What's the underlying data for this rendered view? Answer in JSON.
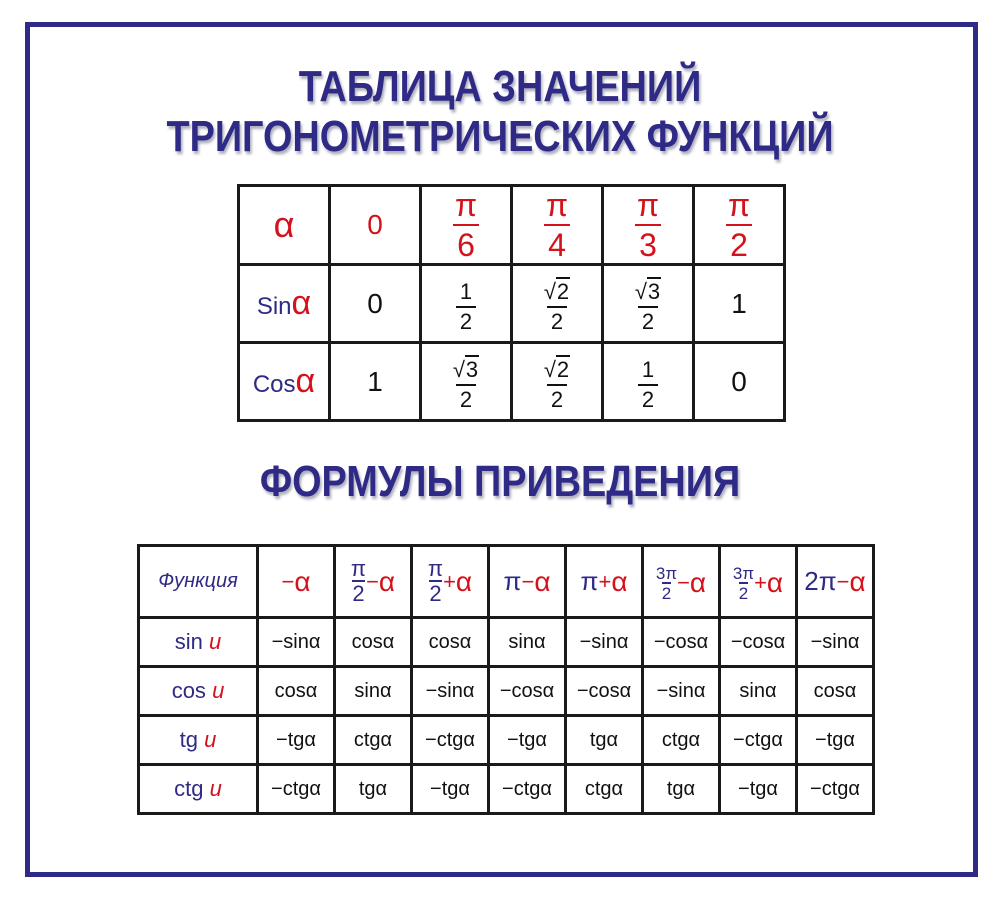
{
  "titles": {
    "main_line1": "ТАБЛИЦА ЗНАЧЕНИЙ",
    "main_line2": "ТРИГОНОМЕТРИЧЕСКИХ ФУНКЦИЙ",
    "section2": "ФОРМУЛЫ ПРИВЕДЕНИЯ"
  },
  "colors": {
    "title": "#2e2a85",
    "accent_red": "#d4121c",
    "grid": "#1a1a1a",
    "frame": "#2e2a85"
  },
  "values_table": {
    "corner": "α",
    "angles": [
      {
        "num": "0",
        "den": ""
      },
      {
        "num": "π",
        "den": "6"
      },
      {
        "num": "π",
        "den": "4"
      },
      {
        "num": "π",
        "den": "3"
      },
      {
        "num": "π",
        "den": "2"
      }
    ],
    "rows": [
      {
        "fn": "Sin",
        "arg": "α",
        "cells": [
          {
            "type": "plain",
            "text": "0"
          },
          {
            "type": "frac",
            "num": "1",
            "den": "2"
          },
          {
            "type": "sqrtfrac",
            "rad": "2",
            "den": "2"
          },
          {
            "type": "sqrtfrac",
            "rad": "3",
            "den": "2"
          },
          {
            "type": "plain",
            "text": "1"
          }
        ]
      },
      {
        "fn": "Cos",
        "arg": "α",
        "cells": [
          {
            "type": "plain",
            "text": "1"
          },
          {
            "type": "sqrtfrac",
            "rad": "3",
            "den": "2"
          },
          {
            "type": "sqrtfrac",
            "rad": "2",
            "den": "2"
          },
          {
            "type": "frac",
            "num": "1",
            "den": "2"
          },
          {
            "type": "plain",
            "text": "0"
          }
        ]
      }
    ]
  },
  "reduction_table": {
    "header_label": "Функция",
    "columns": [
      {
        "pre": "",
        "num": "",
        "den": "",
        "op": "−",
        "arg": "α"
      },
      {
        "pre": "",
        "num": "π",
        "den": "2",
        "op": "−",
        "arg": "α"
      },
      {
        "pre": "",
        "num": "π",
        "den": "2",
        "op": "+",
        "arg": "α"
      },
      {
        "pre": "π",
        "num": "",
        "den": "",
        "op": "−",
        "arg": "α"
      },
      {
        "pre": "π",
        "num": "",
        "den": "",
        "op": "+",
        "arg": "α"
      },
      {
        "pre": "",
        "num": "3π",
        "den": "2",
        "op": "−",
        "arg": "α"
      },
      {
        "pre": "",
        "num": "3π",
        "den": "2",
        "op": "+",
        "arg": "α"
      },
      {
        "pre": "2π",
        "num": "",
        "den": "",
        "op": "−",
        "arg": "α"
      }
    ],
    "rows": [
      {
        "fn": "sin",
        "var": "u",
        "cells": [
          "−sinα",
          "cosα",
          "cosα",
          "sinα",
          "−sinα",
          "−cosα",
          "−cosα",
          "−sinα"
        ]
      },
      {
        "fn": "cos",
        "var": "u",
        "cells": [
          "cosα",
          "sinα",
          "−sinα",
          "−cosα",
          "−cosα",
          "−sinα",
          "sinα",
          "cosα"
        ]
      },
      {
        "fn": "tg",
        "var": "u",
        "cells": [
          "−tgα",
          "ctgα",
          "−ctgα",
          "−tgα",
          "tgα",
          "ctgα",
          "−ctgα",
          "−tgα"
        ]
      },
      {
        "fn": "ctg",
        "var": "u",
        "cells": [
          "−ctgα",
          "tgα",
          "−tgα",
          "−ctgα",
          "ctgα",
          "tgα",
          "−tgα",
          "−ctgα"
        ]
      }
    ]
  }
}
